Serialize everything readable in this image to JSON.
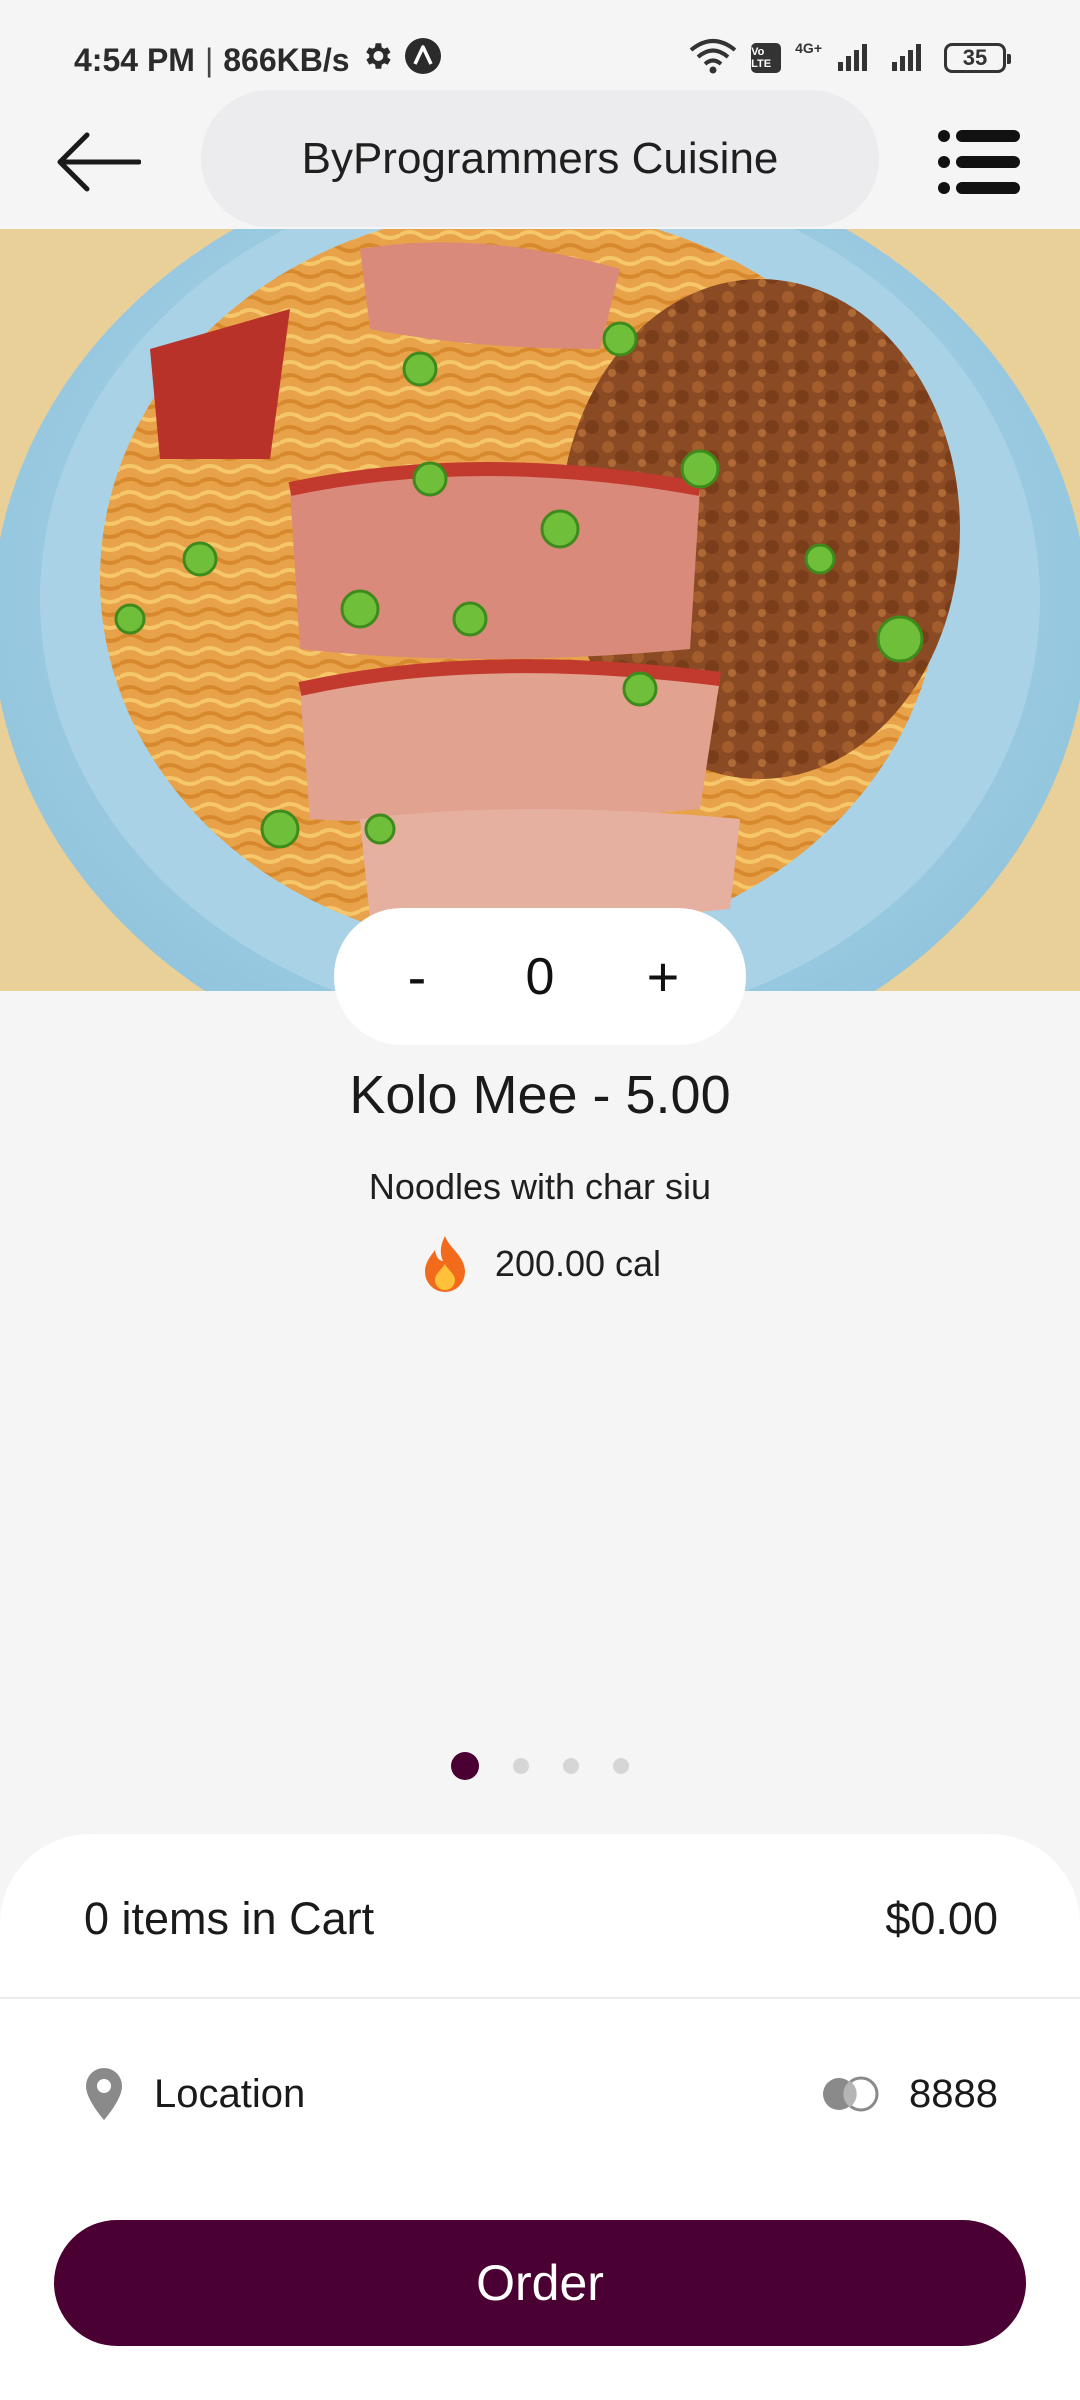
{
  "status_bar": {
    "time": "4:54 PM",
    "separator": "|",
    "network_speed": "866KB/s",
    "network_type": "4G+",
    "volte_label": "Vo LTE",
    "battery_level": "35",
    "icons": [
      "gear-icon",
      "app-a-icon",
      "wifi-icon",
      "volte-icon",
      "signal-icon",
      "signal-icon",
      "battery-icon"
    ]
  },
  "app_bar": {
    "title": "ByProgrammers Cuisine",
    "back_icon": "arrow-left-icon",
    "menu_icon": "list-menu-icon"
  },
  "item": {
    "quantity": "0",
    "decrement_label": "-",
    "increment_label": "+",
    "title": "Kolo Mee - 5.00",
    "description": "Noodles with char siu",
    "calories": "200.00 cal",
    "calorie_icon": "fire-icon",
    "image_icon": "noodle-bowl-image"
  },
  "pager": {
    "count": 4,
    "active_index": 0
  },
  "cart": {
    "items_text": "0 items in Cart",
    "total": "$0.00"
  },
  "location": {
    "label": "Location",
    "location_icon": "location-pin-icon",
    "card_icon": "card-toggle-icon",
    "card_number": "8888"
  },
  "order_button": {
    "label": "Order"
  },
  "colors": {
    "primary": "#4a0032",
    "background": "#f5f5f5",
    "surface": "#ffffff",
    "title_pill": "#ececee",
    "dot_inactive": "#d6d6d6",
    "fire": "#f26b1d"
  }
}
